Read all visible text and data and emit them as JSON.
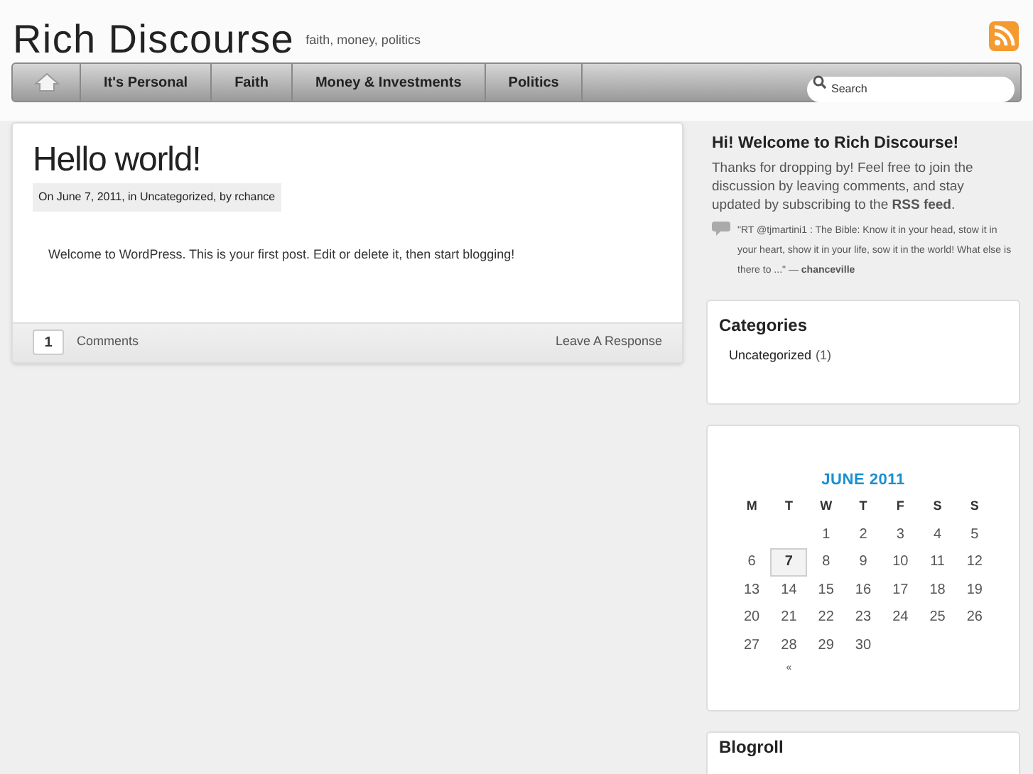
{
  "header": {
    "title": "Rich Discourse",
    "tagline": "faith, money, politics"
  },
  "nav": {
    "items": [
      "It's Personal",
      "Faith",
      "Money & Investments",
      "Politics"
    ],
    "search_placeholder": "Search"
  },
  "post": {
    "title": "Hello world!",
    "meta": "On June 7, 2011, in Uncategorized, by rchance",
    "body": "Welcome to WordPress. This is your first post. Edit or delete it, then start blogging!",
    "comment_count": "1",
    "comments_label": "Comments",
    "response_link": "Leave A Response"
  },
  "welcome": {
    "title": "Hi! Welcome to Rich Discourse!",
    "text": "Thanks for dropping by! Feel free to join the discussion by leaving comments, and stay updated by subscribing to the **RSS feed**.",
    "tweet": "\"RT @tjmartini1 : The Bible: Know it in your head, stow it in your heart, show it in your life, sow it in the world! What else is there to ...\" — **chanceville**"
  },
  "categories": {
    "title": "Categories",
    "items": [
      {
        "name": "Uncategorized",
        "count": "(1)"
      }
    ]
  },
  "calendar": {
    "title": "JUNE 2011",
    "weekdays": [
      "M",
      "T",
      "W",
      "T",
      "F",
      "S",
      "S"
    ],
    "weeks": [
      {
        "days": [
          {
            "day": "1",
            "selected": false
          },
          {
            "day": "2",
            "selected": false
          },
          {
            "day": "3",
            "selected": false
          },
          {
            "day": "4",
            "selected": false
          },
          {
            "day": "5",
            "selected": false
          }
        ]
      },
      {
        "days": [
          {
            "day": "6",
            "selected": false
          },
          {
            "day": "7",
            "selected": true
          },
          {
            "day": "8",
            "selected": false
          },
          {
            "day": "9",
            "selected": false
          },
          {
            "day": "10",
            "selected": false
          },
          {
            "day": "11",
            "selected": false
          },
          {
            "day": "12",
            "selected": false
          }
        ]
      },
      {
        "days": [
          {
            "day": "13",
            "selected": false
          },
          {
            "day": "14",
            "selected": false
          },
          {
            "day": "15",
            "selected": false
          },
          {
            "day": "16",
            "selected": false
          },
          {
            "day": "17",
            "selected": false
          },
          {
            "day": "18",
            "selected": false
          },
          {
            "day": "19",
            "selected": false
          }
        ]
      },
      {
        "days": [
          {
            "day": "20",
            "selected": false
          },
          {
            "day": "21",
            "selected": false
          },
          {
            "day": "22",
            "selected": false
          },
          {
            "day": "23",
            "selected": false
          },
          {
            "day": "24",
            "selected": false
          },
          {
            "day": "25",
            "selected": false
          },
          {
            "day": "26",
            "selected": false
          }
        ]
      },
      {
        "days": [
          {
            "day": "27",
            "selected": false
          },
          {
            "day": "28",
            "selected": false
          },
          {
            "day": "29",
            "selected": false
          },
          {
            "day": "30",
            "selected": false
          }
        ]
      }
    ],
    "prev": "«"
  },
  "blogroll": {
    "title": "Blogroll"
  }
}
